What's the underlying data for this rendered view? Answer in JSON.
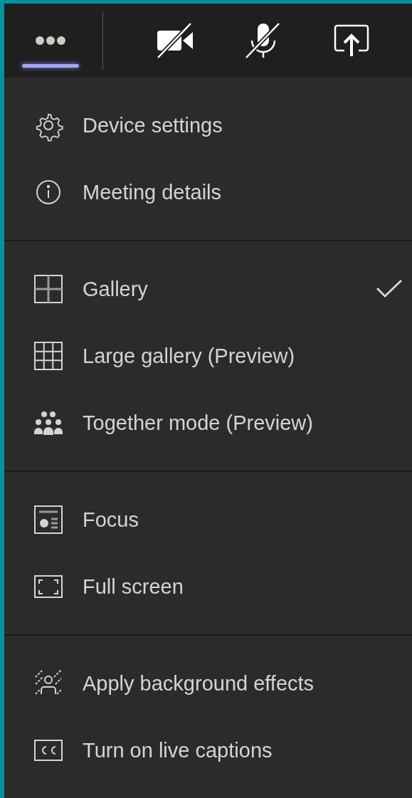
{
  "toolbar": {
    "buttons": [
      {
        "kind": "more",
        "selected": true
      },
      {
        "kind": "camera",
        "on": false
      },
      {
        "kind": "mic",
        "on": false
      },
      {
        "kind": "share"
      }
    ]
  },
  "menu": {
    "groups": [
      {
        "items": [
          {
            "kind": "settings",
            "label": "Device settings",
            "checked": false
          },
          {
            "kind": "info",
            "label": "Meeting details",
            "checked": false
          }
        ]
      },
      {
        "items": [
          {
            "kind": "gallery",
            "label": "Gallery",
            "checked": true
          },
          {
            "kind": "large-gallery",
            "label": "Large gallery (Preview)",
            "checked": false
          },
          {
            "kind": "together",
            "label": "Together mode (Preview)",
            "checked": false
          }
        ]
      },
      {
        "items": [
          {
            "kind": "focus",
            "label": "Focus",
            "checked": false
          },
          {
            "kind": "fullscreen",
            "label": "Full screen",
            "checked": false
          }
        ]
      },
      {
        "items": [
          {
            "kind": "background",
            "label": "Apply background effects",
            "checked": false
          },
          {
            "kind": "captions",
            "label": "Turn on live captions",
            "checked": false
          }
        ]
      }
    ]
  }
}
